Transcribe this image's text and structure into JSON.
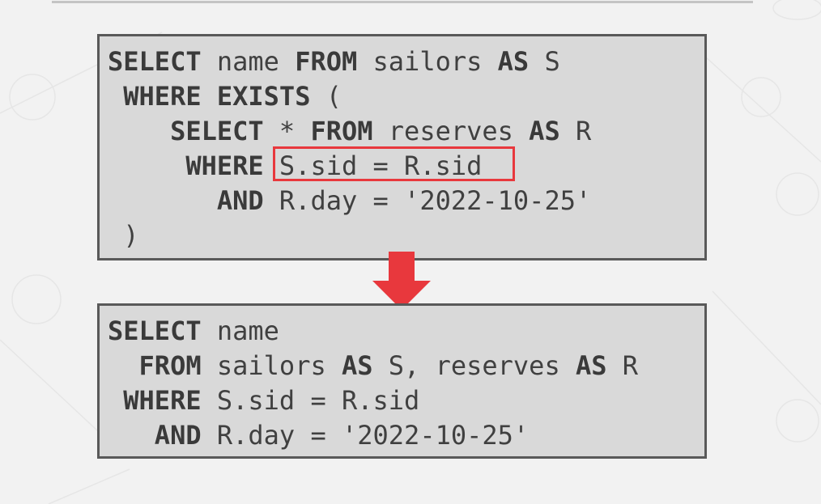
{
  "original_query": {
    "lines": [
      {
        "indent": "",
        "segments": [
          {
            "t": "SELECT",
            "k": true
          },
          {
            "t": " name ",
            "k": false
          },
          {
            "t": "FROM",
            "k": true
          },
          {
            "t": " sailors ",
            "k": false
          },
          {
            "t": "AS",
            "k": true
          },
          {
            "t": " S",
            "k": false
          }
        ]
      },
      {
        "indent": " ",
        "segments": [
          {
            "t": "WHERE",
            "k": true
          },
          {
            "t": " ",
            "k": false
          },
          {
            "t": "EXISTS",
            "k": true
          },
          {
            "t": " (",
            "k": false
          }
        ]
      },
      {
        "indent": "    ",
        "segments": [
          {
            "t": "SELECT",
            "k": true
          },
          {
            "t": " * ",
            "k": false
          },
          {
            "t": "FROM",
            "k": true
          },
          {
            "t": " reserves ",
            "k": false
          },
          {
            "t": "AS",
            "k": true
          },
          {
            "t": " R",
            "k": false
          }
        ]
      },
      {
        "indent": "     ",
        "segments": [
          {
            "t": "WHERE",
            "k": true
          },
          {
            "t": " S.sid = R.sid",
            "k": false
          }
        ]
      },
      {
        "indent": "       ",
        "segments": [
          {
            "t": "AND",
            "k": true
          },
          {
            "t": " R.day = '2022-10-25'",
            "k": false
          }
        ]
      },
      {
        "indent": " ",
        "segments": [
          {
            "t": ")",
            "k": false
          }
        ]
      }
    ],
    "highlighted_predicate": "S.sid = R.sid"
  },
  "rewritten_query": {
    "lines": [
      {
        "indent": "",
        "segments": [
          {
            "t": "SELECT",
            "k": true
          },
          {
            "t": " name",
            "k": false
          }
        ]
      },
      {
        "indent": "  ",
        "segments": [
          {
            "t": "FROM",
            "k": true
          },
          {
            "t": " sailors ",
            "k": false
          },
          {
            "t": "AS",
            "k": true
          },
          {
            "t": " S, reserves ",
            "k": false
          },
          {
            "t": "AS",
            "k": true
          },
          {
            "t": " R",
            "k": false
          }
        ]
      },
      {
        "indent": " ",
        "segments": [
          {
            "t": "WHERE",
            "k": true
          },
          {
            "t": " S.sid = R.sid",
            "k": false
          }
        ]
      },
      {
        "indent": "   ",
        "segments": [
          {
            "t": "AND",
            "k": true
          },
          {
            "t": " R.day = '2022-10-25'",
            "k": false
          }
        ]
      }
    ]
  },
  "colors": {
    "highlight": "#e8383d",
    "arrow": "#e8383d",
    "box_fill": "#d9d9d9",
    "box_border": "#595959"
  },
  "icons": {
    "transform_arrow": "down-arrow-icon"
  }
}
